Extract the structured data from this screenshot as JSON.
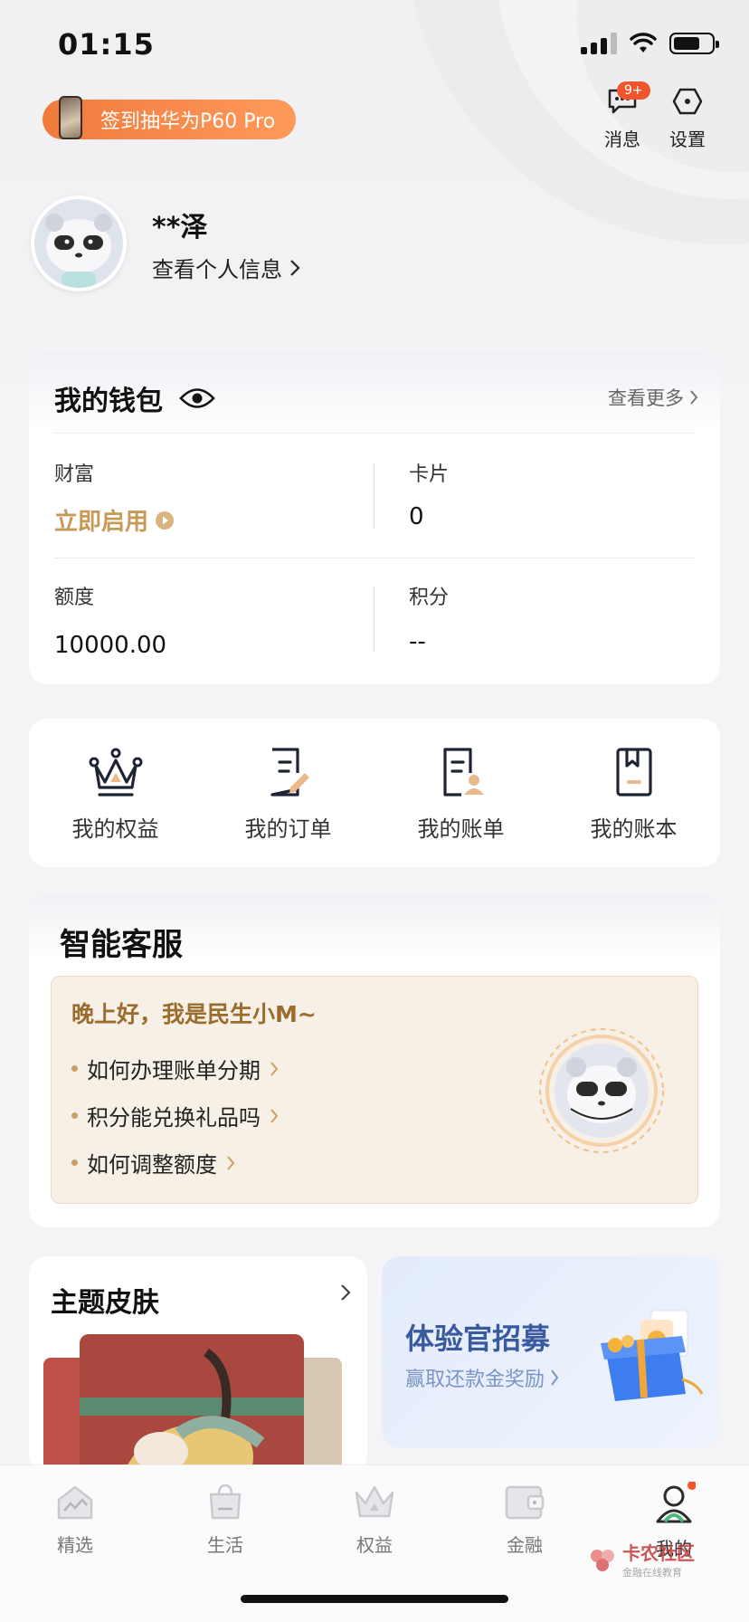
{
  "status_bar": {
    "time": "01:15"
  },
  "promo": {
    "label": "签到抽华为P60 Pro"
  },
  "header": {
    "messages_label": "消息",
    "messages_badge": "9+",
    "settings_label": "设置"
  },
  "profile": {
    "name": "**泽",
    "link_label": "查看个人信息"
  },
  "wallet": {
    "title": "我的钱包",
    "more_label": "查看更多",
    "wealth_label": "财富",
    "wealth_action": "立即启用",
    "cards_label": "卡片",
    "cards_value": "0",
    "limit_label": "额度",
    "limit_value": "10000.00",
    "points_label": "积分",
    "points_value": "--"
  },
  "quick_actions": [
    {
      "label": "我的权益",
      "icon": "crown-icon"
    },
    {
      "label": "我的订单",
      "icon": "order-edit-icon"
    },
    {
      "label": "我的账单",
      "icon": "bill-user-icon"
    },
    {
      "label": "我的账本",
      "icon": "bookmark-book-icon"
    }
  ],
  "service": {
    "title": "智能客服",
    "greeting": "晚上好，我是民生小M~",
    "faqs": [
      "如何办理账单分期",
      "积分能兑换礼品吗",
      "如何调整额度"
    ]
  },
  "theme": {
    "title": "主题皮肤"
  },
  "recruit": {
    "title": "体验官招募",
    "subtitle": "赢取还款金奖励"
  },
  "tabbar": {
    "items": [
      "精选",
      "生活",
      "权益",
      "金融",
      "我的"
    ],
    "active": "我的"
  },
  "watermark": {
    "title": "卡农社区",
    "subtitle": "金融在线教育"
  },
  "colors": {
    "accent_orange": "#f07a3c",
    "gold": "#c79a5a",
    "blue": "#3a5aa0",
    "badge_red": "#f0552c"
  }
}
